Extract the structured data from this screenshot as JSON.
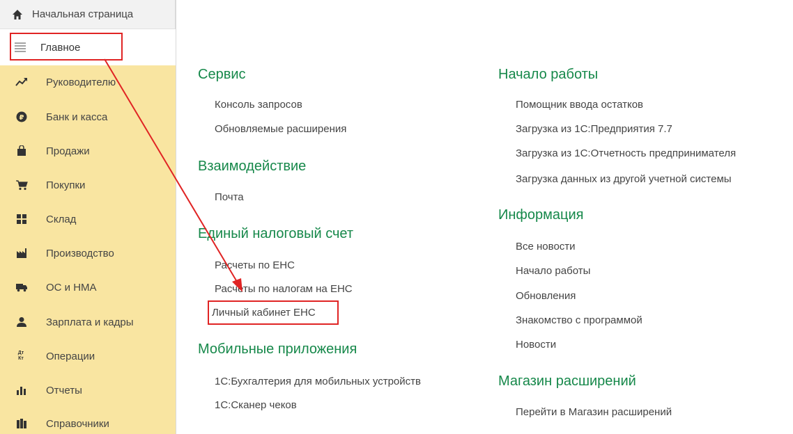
{
  "sidebar": {
    "home": {
      "label": "Начальная страница",
      "icon": "home-icon"
    },
    "main": {
      "label": "Главное",
      "icon": "menu-icon"
    },
    "items": [
      {
        "label": "Руководителю",
        "icon": "trend-icon"
      },
      {
        "label": "Банк и касса",
        "icon": "ruble-icon"
      },
      {
        "label": "Продажи",
        "icon": "shopping-bag-icon"
      },
      {
        "label": "Покупки",
        "icon": "cart-icon"
      },
      {
        "label": "Склад",
        "icon": "warehouse-icon"
      },
      {
        "label": "Производство",
        "icon": "factory-icon"
      },
      {
        "label": "ОС и НМА",
        "icon": "truck-icon"
      },
      {
        "label": "Зарплата и кадры",
        "icon": "person-icon"
      },
      {
        "label": "Операции",
        "icon": "dt-kt-icon",
        "icon_text": "Дт Кт"
      },
      {
        "label": "Отчеты",
        "icon": "bar-chart-icon"
      },
      {
        "label": "Справочники",
        "icon": "books-icon"
      }
    ]
  },
  "content": {
    "servis": {
      "title": "Сервис",
      "links": [
        "Консоль запросов",
        "Обновляемые расширения"
      ]
    },
    "vzaim": {
      "title": "Взаимодействие",
      "links": [
        "Почта"
      ]
    },
    "ens": {
      "title": "Единый налоговый счет",
      "links": [
        "Расчеты по ЕНС",
        "Расчеты по налогам на ЕНС",
        "Личный кабинет ЕНС"
      ]
    },
    "mobile": {
      "title": "Мобильные приложения",
      "links": [
        "1С:Бухгалтерия для мобильных устройств",
        "1С:Сканер чеков"
      ]
    },
    "start": {
      "title": "Начало работы",
      "links": [
        "Помощник ввода остатков",
        "Загрузка из 1С:Предприятия 7.7",
        "Загрузка из 1С:Отчетность предпринимателя",
        "Загрузка данных из другой учетной системы"
      ]
    },
    "info": {
      "title": "Информация",
      "links": [
        "Все новости",
        "Начало работы",
        "Обновления",
        "Знакомство с программой",
        "Новости"
      ]
    },
    "shop": {
      "title": "Магазин расширений",
      "links": [
        "Перейти в Магазин расширений"
      ]
    }
  },
  "colors": {
    "accent_green": "#16884a",
    "sidebar_yellow": "#f9e5a1",
    "highlight_red": "#e02424"
  }
}
